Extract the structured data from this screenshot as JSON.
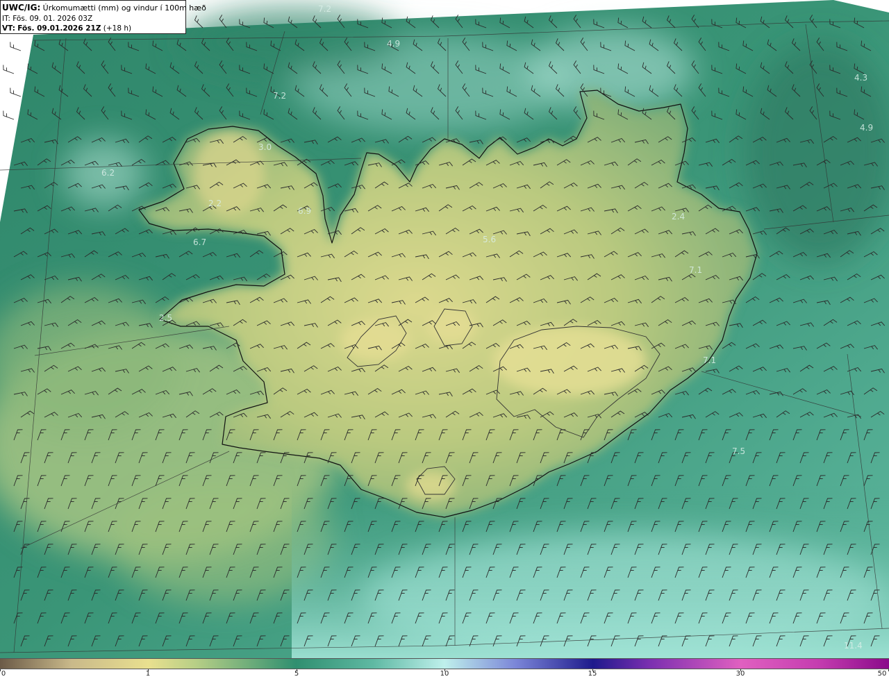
{
  "header": {
    "model": "UWC/IG:",
    "description": "Úrkomumætti (mm) og vindur í 100m hæð",
    "issue_time": "IT: Fös. 09. 01. 2026 03Z",
    "valid_prefix": "VT:",
    "valid_time": "Fös. 09.01.2026 21Z",
    "lead": "(+18 h)"
  },
  "map_labels": [
    {
      "id": "v1",
      "text": "7.2"
    },
    {
      "id": "v2",
      "text": "4.9"
    },
    {
      "id": "v3",
      "text": "7.2"
    },
    {
      "id": "v4",
      "text": "3.0"
    },
    {
      "id": "v5",
      "text": "6.2"
    },
    {
      "id": "v6",
      "text": "2.2"
    },
    {
      "id": "v7",
      "text": "6.9"
    },
    {
      "id": "v8",
      "text": "6.7"
    },
    {
      "id": "v9",
      "text": "5.6"
    },
    {
      "id": "v10",
      "text": "2.4"
    },
    {
      "id": "v11",
      "text": "7.1"
    },
    {
      "id": "v12",
      "text": "4.3"
    },
    {
      "id": "v13",
      "text": "4.9"
    },
    {
      "id": "v14",
      "text": "2.5"
    },
    {
      "id": "v15",
      "text": "7.1"
    },
    {
      "id": "v16",
      "text": "7.5"
    },
    {
      "id": "v17",
      "text": "11.4"
    }
  ],
  "colorbar": {
    "unit": "mm",
    "ticks": [
      "0",
      "1",
      "5",
      "10",
      "15",
      "30",
      "50"
    ],
    "colors": {
      "dry": "#6b5a47",
      "low": "#e9e08f",
      "mid": "#2f8f70",
      "high": "#bff0ec",
      "heavy": "#1e1a8c",
      "extreme": "#e060c0",
      "max": "#8a0a8a"
    }
  },
  "map_colors": {
    "ocean_dark": "#2c7f66",
    "ocean_mid": "#3f9a7c",
    "ocean_light": "#8fd8c8",
    "land_dry": "#cfd58a",
    "land_mid": "#97b874",
    "coastline": "#111111",
    "gridline": "#333333",
    "wind_barb": "#2a2a2a"
  }
}
